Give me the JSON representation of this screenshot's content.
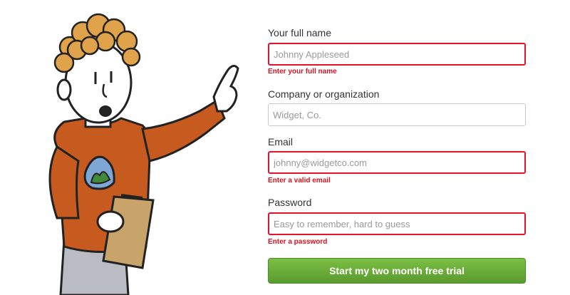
{
  "form": {
    "full_name": {
      "label": "Your full name",
      "placeholder": "Johnny Appleseed",
      "value": "",
      "error": "Enter your full name"
    },
    "company": {
      "label": "Company or organization",
      "placeholder": "Widget, Co.",
      "value": ""
    },
    "email": {
      "label": "Email",
      "placeholder": "johnny@widgetco.com",
      "value": "",
      "error": "Enter a valid email"
    },
    "password": {
      "label": "Password",
      "placeholder": "Easy to remember, hard to guess",
      "value": "",
      "error": "Enter a password"
    },
    "submit_label": "Start my two month free trial"
  },
  "colors": {
    "error": "#e2132e",
    "button_green": "#6aad38",
    "label_text": "#333333"
  },
  "illustration": {
    "icon": "cartoon-person-pointing-icon"
  }
}
